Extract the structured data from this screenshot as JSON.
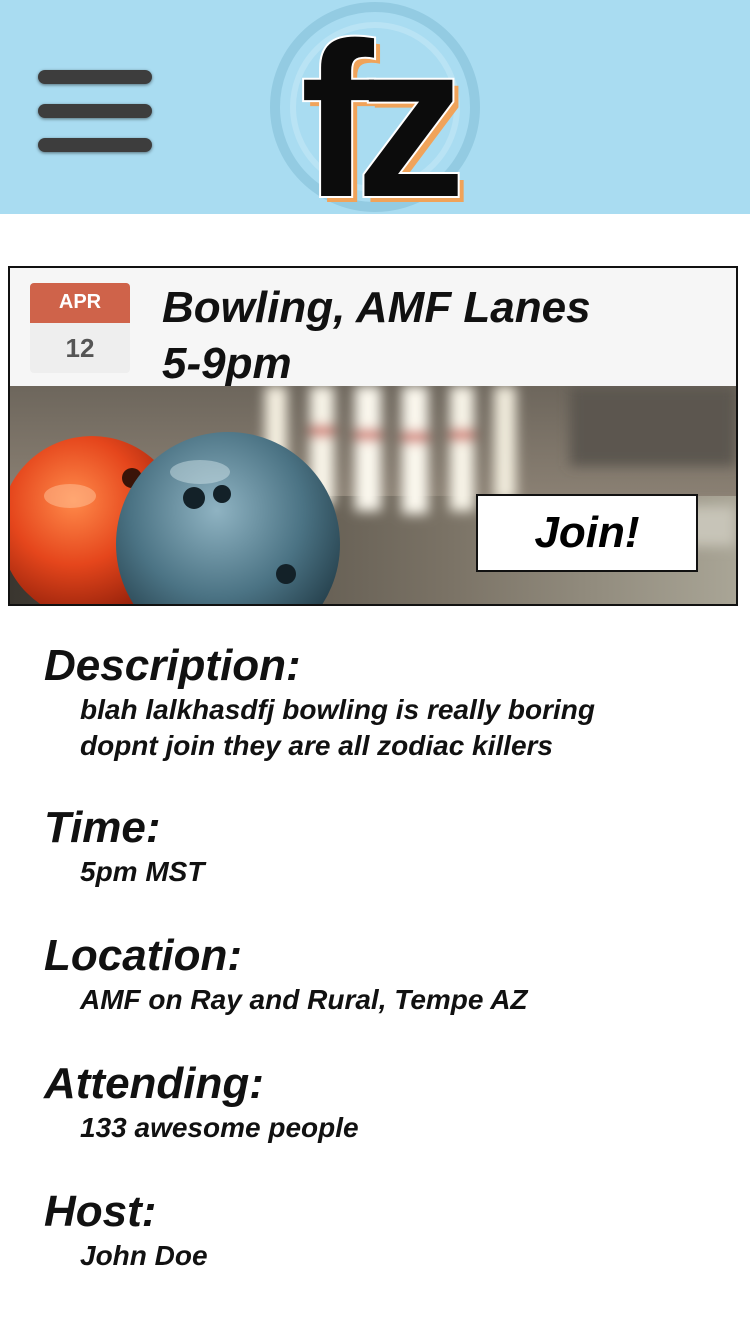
{
  "header": {
    "menu_icon": "hamburger-menu-icon",
    "logo_text": "fz",
    "background": "#a9dcf1"
  },
  "event": {
    "date": {
      "month": "APR",
      "day": "12"
    },
    "title_lines": [
      "Bowling, AMF Lanes",
      "5-9pm"
    ],
    "photo": "bowling-balls-and-pins",
    "join_label": "Join!"
  },
  "details": {
    "description": {
      "heading": "Description:",
      "lines": [
        "blah lalkhasdfj bowling is  really boring",
        "dopnt join they are all zodiac killers"
      ]
    },
    "time": {
      "heading": "Time:",
      "value": "5pm MST"
    },
    "location": {
      "heading": "Location:",
      "value": "AMF on Ray and Rural, Tempe AZ"
    },
    "attending": {
      "heading": "Attending:",
      "value": "133 awesome people"
    },
    "host": {
      "heading": "Host:",
      "value": "John Doe"
    }
  },
  "colors": {
    "accent_date": "#cf634a",
    "logo_orange": "#f0a35a"
  }
}
